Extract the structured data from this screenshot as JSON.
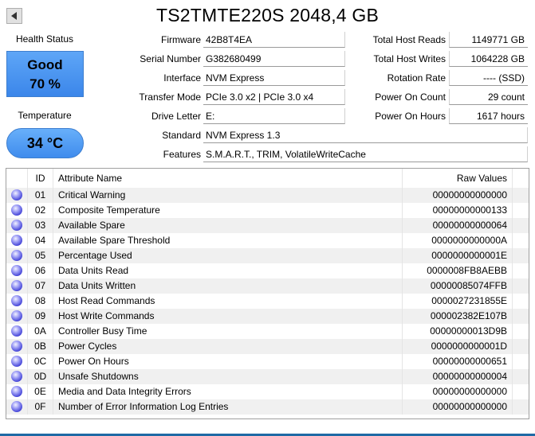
{
  "title": "TS2TMTE220S 2048,4 GB",
  "health": {
    "label": "Health Status",
    "status": "Good",
    "percent": "70 %"
  },
  "temperature": {
    "label": "Temperature",
    "value": "34 °C"
  },
  "info": {
    "firmware": {
      "label": "Firmware",
      "value": "42B8T4EA"
    },
    "serial": {
      "label": "Serial Number",
      "value": "G382680499"
    },
    "interface": {
      "label": "Interface",
      "value": "NVM Express"
    },
    "transfer": {
      "label": "Transfer Mode",
      "value": "PCIe 3.0 x2 | PCIe 3.0 x4"
    },
    "drive_letter": {
      "label": "Drive Letter",
      "value": "E:"
    },
    "standard": {
      "label": "Standard",
      "value": "NVM Express 1.3"
    },
    "features": {
      "label": "Features",
      "value": "S.M.A.R.T., TRIM, VolatileWriteCache"
    }
  },
  "stats": {
    "host_reads": {
      "label": "Total Host Reads",
      "value": "1149771 GB"
    },
    "host_writes": {
      "label": "Total Host Writes",
      "value": "1064228 GB"
    },
    "rotation": {
      "label": "Rotation Rate",
      "value": "---- (SSD)"
    },
    "power_count": {
      "label": "Power On Count",
      "value": "29 count"
    },
    "power_hours": {
      "label": "Power On Hours",
      "value": "1617 hours"
    }
  },
  "table": {
    "headers": {
      "id": "ID",
      "name": "Attribute Name",
      "raw": "Raw Values"
    },
    "rows": [
      {
        "id": "01",
        "name": "Critical Warning",
        "raw": "00000000000000"
      },
      {
        "id": "02",
        "name": "Composite Temperature",
        "raw": "00000000000133"
      },
      {
        "id": "03",
        "name": "Available Spare",
        "raw": "00000000000064"
      },
      {
        "id": "04",
        "name": "Available Spare Threshold",
        "raw": "0000000000000A"
      },
      {
        "id": "05",
        "name": "Percentage Used",
        "raw": "0000000000001E"
      },
      {
        "id": "06",
        "name": "Data Units Read",
        "raw": "0000008FB8AEBB"
      },
      {
        "id": "07",
        "name": "Data Units Written",
        "raw": "00000085074FFB"
      },
      {
        "id": "08",
        "name": "Host Read Commands",
        "raw": "0000027231855E"
      },
      {
        "id": "09",
        "name": "Host Write Commands",
        "raw": "000002382E107B"
      },
      {
        "id": "0A",
        "name": "Controller Busy Time",
        "raw": "00000000013D9B"
      },
      {
        "id": "0B",
        "name": "Power Cycles",
        "raw": "0000000000001D"
      },
      {
        "id": "0C",
        "name": "Power On Hours",
        "raw": "00000000000651"
      },
      {
        "id": "0D",
        "name": "Unsafe Shutdowns",
        "raw": "00000000000004"
      },
      {
        "id": "0E",
        "name": "Media and Data Integrity Errors",
        "raw": "00000000000000"
      },
      {
        "id": "0F",
        "name": "Number of Error Information Log Entries",
        "raw": "00000000000000"
      }
    ]
  }
}
